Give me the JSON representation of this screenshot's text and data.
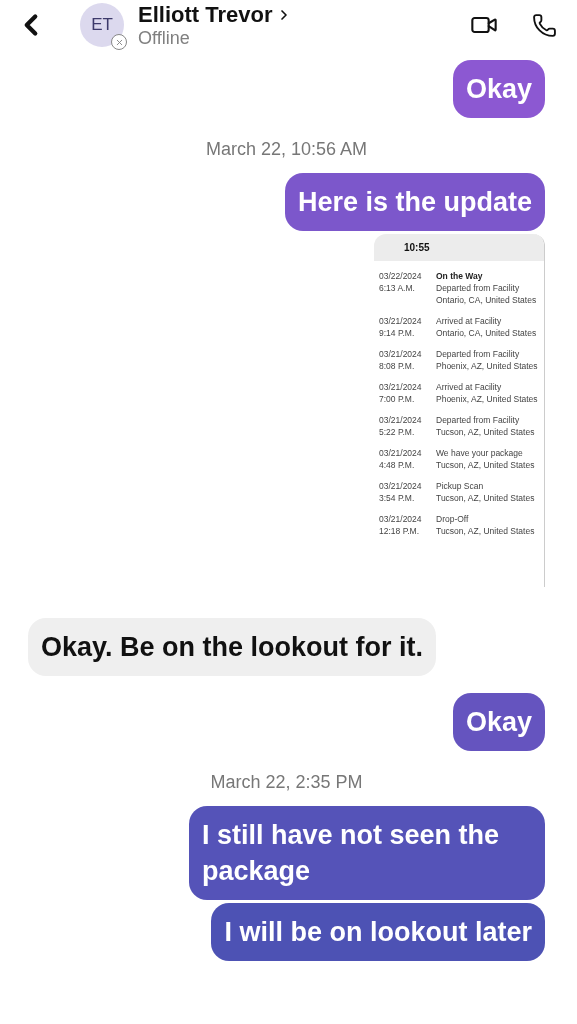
{
  "header": {
    "avatar_initials": "ET",
    "name": "Elliott Trevor",
    "status": "Offline",
    "offline": true
  },
  "messages": [
    {
      "kind": "outgoing",
      "text": "Okay"
    },
    {
      "kind": "timestamp",
      "text": "March 22, 10:56 AM"
    },
    {
      "kind": "outgoing",
      "text": "Here is the update"
    },
    {
      "kind": "image",
      "clock": "10:55",
      "entries": [
        {
          "date": "03/22/2024",
          "time": "6:13 A.M.",
          "emphasis": true,
          "lines": [
            "On the Way",
            "Departed from Facility",
            "Ontario, CA, United States"
          ]
        },
        {
          "date": "03/21/2024",
          "time": "9:14 P.M.",
          "emphasis": false,
          "lines": [
            "Arrived at Facility",
            "Ontario, CA, United States"
          ]
        },
        {
          "date": "03/21/2024",
          "time": "8:08 P.M.",
          "emphasis": false,
          "lines": [
            "Departed from Facility",
            "Phoenix, AZ, United States"
          ]
        },
        {
          "date": "03/21/2024",
          "time": "7:00 P.M.",
          "emphasis": false,
          "lines": [
            "Arrived at Facility",
            "Phoenix, AZ, United States"
          ]
        },
        {
          "date": "03/21/2024",
          "time": "5:22 P.M.",
          "emphasis": false,
          "lines": [
            "Departed from Facility",
            "Tucson, AZ, United States"
          ]
        },
        {
          "date": "03/21/2024",
          "time": "4:48 P.M.",
          "emphasis": false,
          "lines": [
            "We have your package",
            "Tucson, AZ, United States"
          ]
        },
        {
          "date": "03/21/2024",
          "time": "3:54 P.M.",
          "emphasis": false,
          "lines": [
            "Pickup Scan",
            "Tucson, AZ, United States"
          ]
        },
        {
          "date": "03/21/2024",
          "time": "12:18 P.M.",
          "emphasis": false,
          "lines": [
            "Drop-Off",
            "Tucson, AZ, United States"
          ]
        }
      ]
    },
    {
      "kind": "incoming",
      "text": "Okay. Be on the lookout for it."
    },
    {
      "kind": "outgoing",
      "text": "Okay"
    },
    {
      "kind": "timestamp",
      "text": "March 22, 2:35 PM"
    },
    {
      "kind": "outgoing",
      "text": "I still have not seen the package"
    },
    {
      "kind": "outgoing",
      "text": "I will be on lookout later"
    }
  ]
}
